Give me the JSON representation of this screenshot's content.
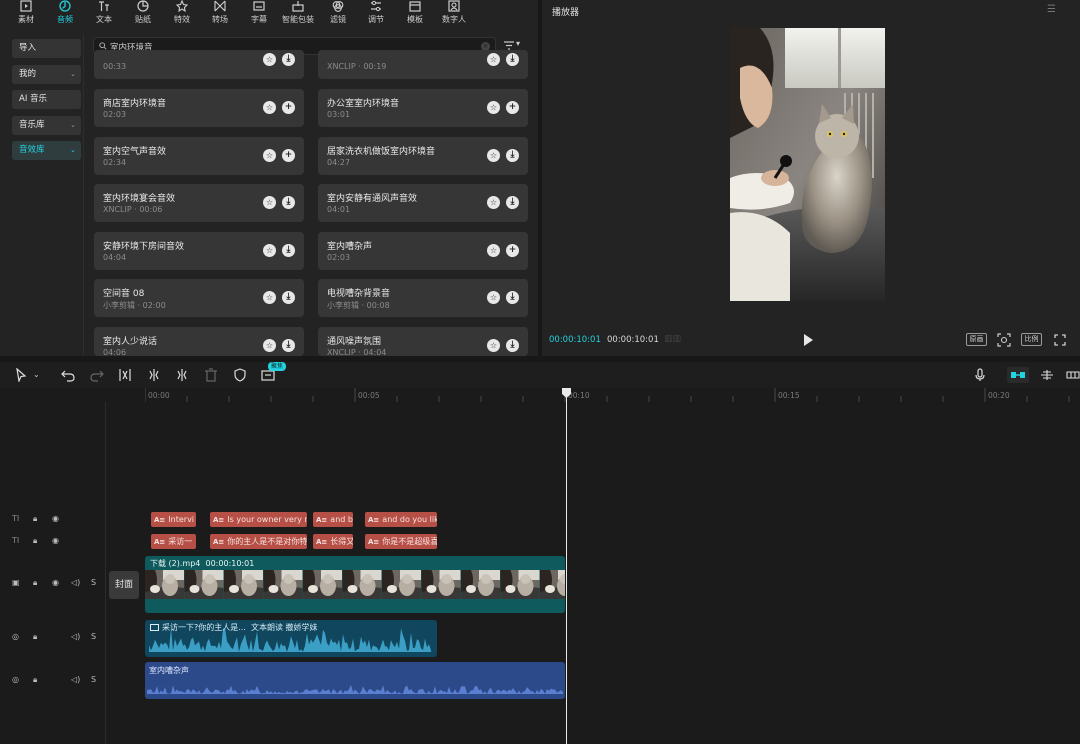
{
  "toolbar": {
    "items": [
      {
        "label": "素材",
        "icon": "media-icon"
      },
      {
        "label": "音频",
        "icon": "audio-icon",
        "active": true
      },
      {
        "label": "文本",
        "icon": "text-icon"
      },
      {
        "label": "贴纸",
        "icon": "sticker-icon"
      },
      {
        "label": "特效",
        "icon": "effects-icon"
      },
      {
        "label": "转场",
        "icon": "transition-icon"
      },
      {
        "label": "字幕",
        "icon": "caption-icon"
      },
      {
        "label": "智能包装",
        "icon": "smart-package-icon"
      },
      {
        "label": "滤镜",
        "icon": "filter-icon"
      },
      {
        "label": "调节",
        "icon": "adjust-icon"
      },
      {
        "label": "模板",
        "icon": "template-icon"
      },
      {
        "label": "数字人",
        "icon": "digital-human-icon"
      }
    ]
  },
  "left_nav": {
    "items": [
      {
        "label": "导入",
        "chevron": false
      },
      {
        "label": "我的",
        "chevron": true
      },
      {
        "label": "AI 音乐",
        "chevron": false
      },
      {
        "label": "音乐库",
        "chevron": true
      },
      {
        "label": "音效库",
        "chevron": true,
        "active": true
      }
    ]
  },
  "search": {
    "value": "室内环境音",
    "filter_label": "▾"
  },
  "sound_list": {
    "top_partial": [
      {
        "meta": "00:33"
      },
      {
        "meta": "XNCLIP · 00:19"
      }
    ],
    "cards": [
      {
        "title": "商店室内环境音",
        "meta": "02:03",
        "action": "add"
      },
      {
        "title": "办公室室内环境音",
        "meta": "03:01",
        "action": "add"
      },
      {
        "title": "室内空气声音效",
        "meta": "02:34",
        "action": "add"
      },
      {
        "title": "居家洗衣机做饭室内环境音",
        "meta": "04:27",
        "action": "download"
      },
      {
        "title": "室内环境宴会音效",
        "meta": "XNCLIP · 00:06",
        "action": "download"
      },
      {
        "title": "室内安静有通风声音效",
        "meta": "04:01",
        "action": "download"
      },
      {
        "title": "安静环境下房间音效",
        "meta": "04:04",
        "action": "download"
      },
      {
        "title": "室内嘈杂声",
        "meta": "02:03",
        "action": "add"
      },
      {
        "title": "空间音 08",
        "meta": "小李剪辑 · 02:00",
        "action": "download"
      },
      {
        "title": "电视嘈杂背景音",
        "meta": "小李剪辑 · 00:08",
        "action": "download"
      },
      {
        "title": "室内人少说话",
        "meta": "04:06",
        "action": "download"
      },
      {
        "title": "通风噪声氛围",
        "meta": "XNCLIP · 04:04",
        "action": "download"
      }
    ]
  },
  "player": {
    "title": "播放器",
    "current_time": "00:00:10:01",
    "total_time": "00:00:10:01",
    "original_label": "原画",
    "ratio_label": "比例"
  },
  "timeline": {
    "badge": "聚焦",
    "ruler": [
      "00:00",
      "00:05",
      "00:10",
      "00:15",
      "00:20"
    ],
    "text_track_1": [
      "Intervi",
      "Is your owner very ni",
      "and b",
      "and do you lik"
    ],
    "text_track_2": [
      "采访一",
      "你的主人是不是对你特",
      "长得又",
      "你是不是超级喜"
    ],
    "text_tag": "A≡",
    "video_clip": {
      "name": "下载 (2).mp4",
      "duration": "00:00:10:01"
    },
    "cover_label": "封面",
    "voice_clip": {
      "text": "采访一下?你的主人是...",
      "tts": "文本朗读 撒娇学妹"
    },
    "ambient_clip": {
      "name": "室内嘈杂声"
    },
    "track_header": {
      "text_icon": "TI",
      "s_label": "S"
    }
  },
  "colors": {
    "accent": "#22d3e0",
    "text_clip": "#b64f46",
    "video_clip": "#0f5a5c",
    "voice_clip": "#10465e",
    "ambient_clip": "#2c4a8a"
  }
}
